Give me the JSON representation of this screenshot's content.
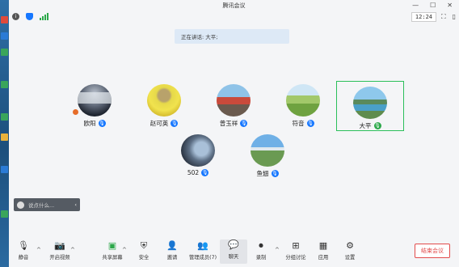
{
  "window": {
    "title": "腾讯会议"
  },
  "status": {
    "clock": "12:24"
  },
  "speaking": {
    "label": "正在讲话: 大平;"
  },
  "participants": [
    {
      "name": "欧阳",
      "mic": "blue"
    },
    {
      "name": "赵可英",
      "mic": "blue"
    },
    {
      "name": "曾玉祥",
      "mic": "blue"
    },
    {
      "name": "符音",
      "mic": "blue"
    },
    {
      "name": "大平",
      "mic": "green",
      "active": true
    },
    {
      "name": "502",
      "mic": "blue"
    },
    {
      "name": "鱼翅",
      "mic": "blue"
    }
  ],
  "chat": {
    "placeholder": "说点什么..."
  },
  "toolbar": {
    "mute": "静音",
    "video": "开启视频",
    "share": "共享屏幕",
    "security": "安全",
    "invite": "邀请",
    "members": "管理成员(7)",
    "chat": "聊天",
    "record": "录制",
    "breakout": "分组讨论",
    "apps": "应用",
    "settings": "设置",
    "end": "结束会议"
  },
  "colors": {
    "accent": "#1677ff",
    "active_border": "#2bbf5a",
    "end": "#e24b4b"
  }
}
